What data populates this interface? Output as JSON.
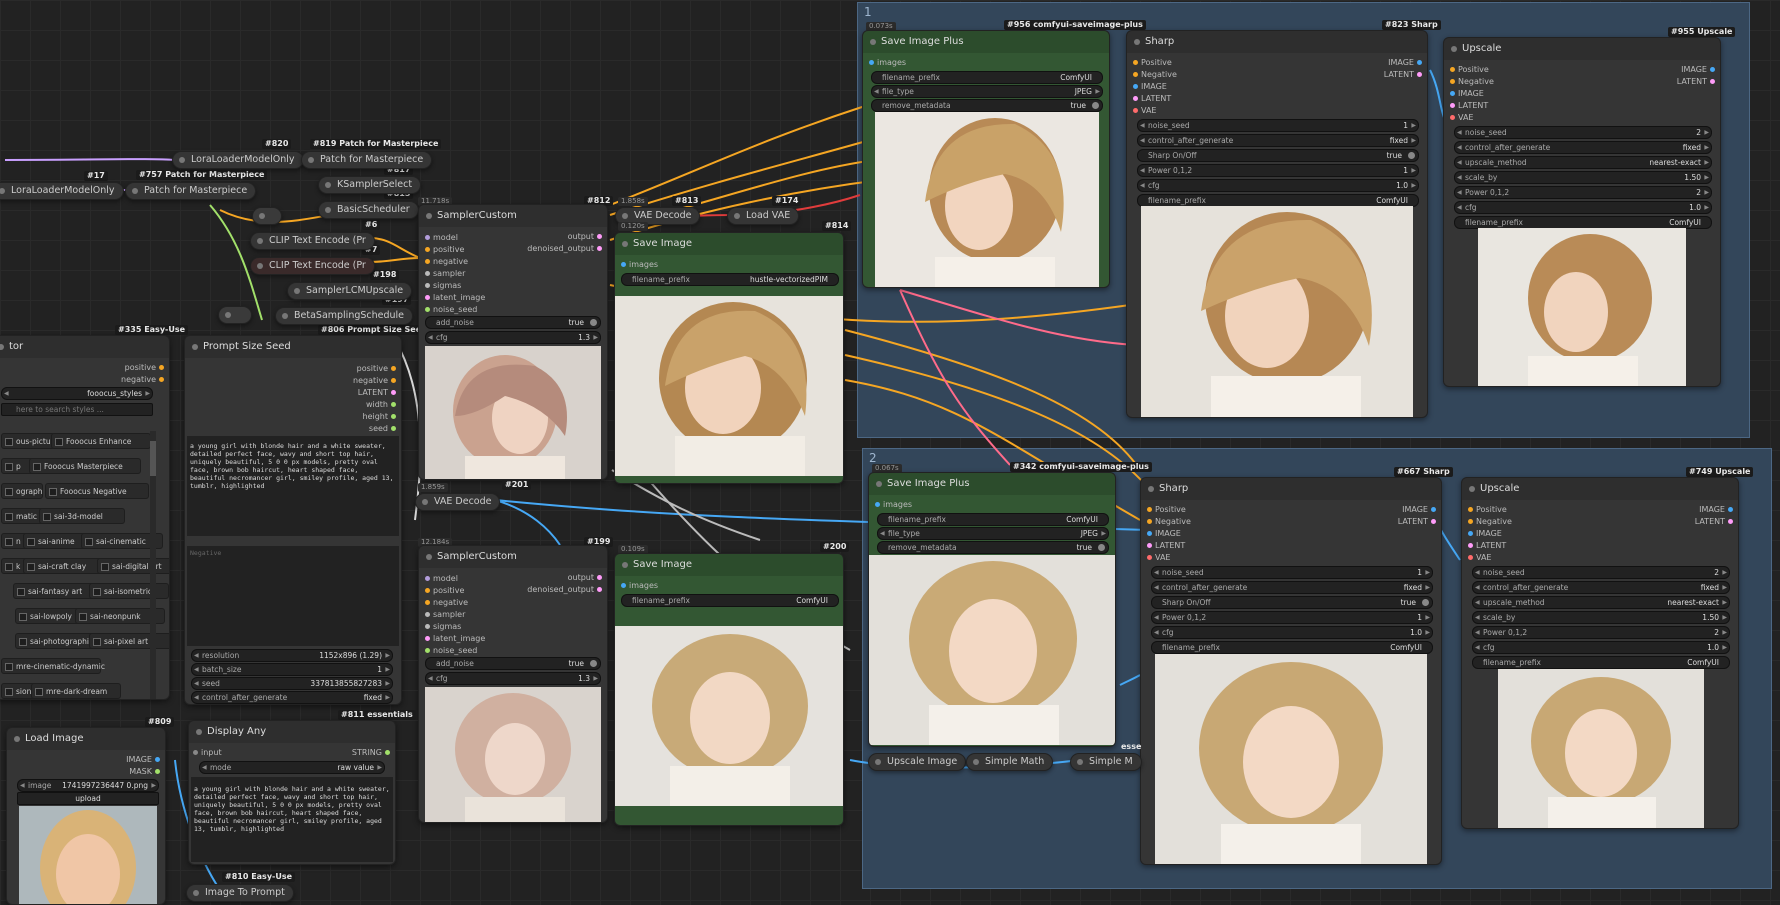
{
  "groups": {
    "top": "1",
    "bottom": "2"
  },
  "colors": {
    "wire_orange": "#f5a623",
    "wire_blue": "#46a8f5",
    "wire_pink": "#ff6b8a",
    "wire_white": "#d8d8d8",
    "wire_purple": "#c9a0ff",
    "wire_green": "#a2e06a",
    "wire_red": "#e03c3c"
  },
  "tags": {
    "n820": "#820",
    "n819": "#819 Patch for Masterpiece",
    "n817": "#817",
    "n757": "#757 Patch for Masterpiece",
    "n17": "#17",
    "n815": "#815",
    "n6": "#6",
    "n7": "#7",
    "n198": "#198",
    "n197": "#197",
    "n806": "#806 Prompt Size Seed",
    "n335": "#335 Easy-Use",
    "n812": "#812",
    "n813": "#813",
    "n174": "#174",
    "n814": "#814",
    "n201": "#201",
    "n199": "#199",
    "n200": "#200",
    "n809": "#809",
    "n811": "#811 essentials",
    "n810": "#810 Easy-Use",
    "n956": "#956 comfyui-saveimage-plus",
    "n823": "#823 Sharp",
    "n955": "#955 Upscale",
    "n342": "#342 comfyui-saveimage-plus",
    "n667": "#667 Sharp",
    "n749": "#749 Upscale"
  },
  "times": {
    "t1": "11.718s",
    "t2": "1.858s",
    "t3": "0.120s",
    "t4": "0.073s",
    "t5": "1.859s",
    "t6": "12.184s",
    "t7": "0.109s",
    "t8": "0.067s"
  },
  "pills": {
    "lora1": "LoraLoaderModelOnly",
    "lora2": "LoraLoaderModelOnly",
    "patch1": "Patch for Masterpiece",
    "patch2": "Patch for Masterpiece",
    "ksampler": "KSamplerSelect",
    "basic": "BasicScheduler",
    "clip1": "CLIP Text Encode (Pr",
    "clip2": "CLIP Text Encode (Pr",
    "lcm": "SamplerLCMUpscale",
    "beta": "BetaSamplingSchedule",
    "vaedec1": "VAE Decode",
    "loadvae": "Load VAE",
    "vaedec2": "VAE Decode",
    "upscaleimg": "Upscale Image",
    "smath1": "Simple Math",
    "smath2": "Simple M",
    "img2prompt": "Image To Prompt",
    "esse": "esse"
  },
  "styler": {
    "partial_title": "tor",
    "out_positive": "positive",
    "out_negative": "negative",
    "styles": "fooocus_styles",
    "search_placeholder": "here to search styles ...",
    "chips": [
      "ous-picture",
      "Fooocus Enhance",
      "p",
      "Fooocus Masterpiece",
      "ograph",
      "Fooocus Negative",
      "matic",
      "sai-3d-model",
      "n",
      "sai-anime",
      "sai-cinematic",
      "k",
      "sai-craft clay",
      "sai-digital art",
      "sai-fantasy art",
      "sai-isometric",
      "sai-lowpoly",
      "sai-neonpunk",
      "sai-photographic",
      "sai-pixel art",
      "mre-cinematic-dynamic",
      "sion",
      "mre-dark-dream"
    ]
  },
  "prompt_node": {
    "title": "Prompt Size Seed",
    "outputs": [
      "positive",
      "negative",
      "LATENT",
      "width",
      "height",
      "seed"
    ],
    "prompt_text": "a young girl with blonde hair and a white sweater, detailed perfect face, wavy and short top hair, uniquely beautiful, 5 0 0 px models, pretty oval face, brown bob haircut, heart shaped face, beautiful necromancer girl, smiley profile, aged 13, tumblr, highlighted",
    "negative_placeholder": "Negative",
    "widgets": [
      {
        "l": "resolution",
        "v": "1152x896 (1.29)"
      },
      {
        "l": "batch_size",
        "v": "1"
      },
      {
        "l": "seed",
        "v": "337813855827283"
      },
      {
        "l": "control_after_generate",
        "v": "fixed"
      }
    ]
  },
  "sampler1": {
    "title": "SamplerCustom",
    "inputs": [
      "model",
      "positive",
      "negative",
      "sampler",
      "sigmas",
      "latent_image",
      "noise_seed"
    ],
    "outputs": [
      "output",
      "denoised_output"
    ],
    "add_noise_l": "add_noise",
    "add_noise_v": "true",
    "cfg_l": "cfg",
    "cfg_v": "1.3"
  },
  "sampler2": {
    "title": "SamplerCustom",
    "inputs": [
      "model",
      "positive",
      "negative",
      "sampler",
      "sigmas",
      "latent_image",
      "noise_seed"
    ],
    "outputs": [
      "output",
      "denoised_output"
    ],
    "add_noise_l": "add_noise",
    "add_noise_v": "true",
    "cfg_l": "cfg",
    "cfg_v": "1.3"
  },
  "save1": {
    "title": "Save Image",
    "input": "images",
    "prefix_l": "filename_prefix",
    "prefix_v": "hustle-vectorizedPIM"
  },
  "save2": {
    "title": "Save Image",
    "input": "images",
    "prefix_l": "filename_prefix",
    "prefix_v": "ComfyUI"
  },
  "loadimg": {
    "title": "Load Image",
    "out1": "IMAGE",
    "out2": "MASK",
    "image_l": "image",
    "image_v": "1741997236447 0.png",
    "upload": "upload"
  },
  "display": {
    "title": "Display Any",
    "input": "input",
    "output": "STRING",
    "mode_l": "mode",
    "mode_v": "raw value",
    "text": "a young girl with blonde hair and a white sweater, detailed perfect face, wavy and short top hair, uniquely beautiful, 5 0 0 px models, pretty oval face, brown bob haircut, heart shaped face, beautiful necromancer girl, smiley profile, aged 13, tumblr, highlighted"
  },
  "saveplus1": {
    "title": "Save Image Plus",
    "input": "images",
    "w": [
      {
        "l": "filename_prefix",
        "v": "ComfyUI"
      },
      {
        "l": "file_type",
        "v": "JPEG"
      },
      {
        "l": "remove_metadata",
        "v": "true"
      }
    ]
  },
  "saveplus2": {
    "title": "Save Image Plus",
    "input": "images",
    "w": [
      {
        "l": "filename_prefix",
        "v": "ComfyUI"
      },
      {
        "l": "file_type",
        "v": "JPEG"
      },
      {
        "l": "remove_metadata",
        "v": "true"
      }
    ]
  },
  "sharp1": {
    "title": "Sharp",
    "inputs": [
      "Positive",
      "Negative",
      "IMAGE",
      "LATENT",
      "VAE"
    ],
    "outputs": [
      "IMAGE",
      "LATENT"
    ],
    "w": [
      {
        "l": "noise_seed",
        "v": "1"
      },
      {
        "l": "control_after_generate",
        "v": "fixed"
      },
      {
        "l": "Sharp On/Off",
        "v": "true"
      },
      {
        "l": "Power 0,1,2",
        "v": "1"
      },
      {
        "l": "cfg",
        "v": "1.0"
      },
      {
        "l": "filename_prefix",
        "v": "ComfyUI"
      }
    ]
  },
  "sharp2": {
    "title": "Sharp",
    "inputs": [
      "Positive",
      "Negative",
      "IMAGE",
      "LATENT",
      "VAE"
    ],
    "outputs": [
      "IMAGE",
      "LATENT"
    ],
    "w": [
      {
        "l": "noise_seed",
        "v": "1"
      },
      {
        "l": "control_after_generate",
        "v": "fixed"
      },
      {
        "l": "Sharp On/Off",
        "v": "true"
      },
      {
        "l": "Power 0,1,2",
        "v": "1"
      },
      {
        "l": "cfg",
        "v": "1.0"
      },
      {
        "l": "filename_prefix",
        "v": "ComfyUI"
      }
    ]
  },
  "up1": {
    "title": "Upscale",
    "inputs": [
      "Positive",
      "Negative",
      "IMAGE",
      "LATENT",
      "VAE"
    ],
    "outputs": [
      "IMAGE",
      "LATENT"
    ],
    "w": [
      {
        "l": "noise_seed",
        "v": "2"
      },
      {
        "l": "control_after_generate",
        "v": "fixed"
      },
      {
        "l": "upscale_method",
        "v": "nearest-exact"
      },
      {
        "l": "scale_by",
        "v": "1.50"
      },
      {
        "l": "Power 0,1,2",
        "v": "2"
      },
      {
        "l": "cfg",
        "v": "1.0"
      },
      {
        "l": "filename_prefix",
        "v": "ComfyUI"
      }
    ]
  },
  "up2": {
    "title": "Upscale",
    "inputs": [
      "Positive",
      "Negative",
      "IMAGE",
      "LATENT",
      "VAE"
    ],
    "outputs": [
      "IMAGE",
      "LATENT"
    ],
    "w": [
      {
        "l": "noise_seed",
        "v": "2"
      },
      {
        "l": "control_after_generate",
        "v": "fixed"
      },
      {
        "l": "upscale_method",
        "v": "nearest-exact"
      },
      {
        "l": "scale_by",
        "v": "1.50"
      },
      {
        "l": "Power 0,1,2",
        "v": "2"
      },
      {
        "l": "cfg",
        "v": "1.0"
      },
      {
        "l": "filename_prefix",
        "v": "ComfyUI"
      }
    ]
  }
}
